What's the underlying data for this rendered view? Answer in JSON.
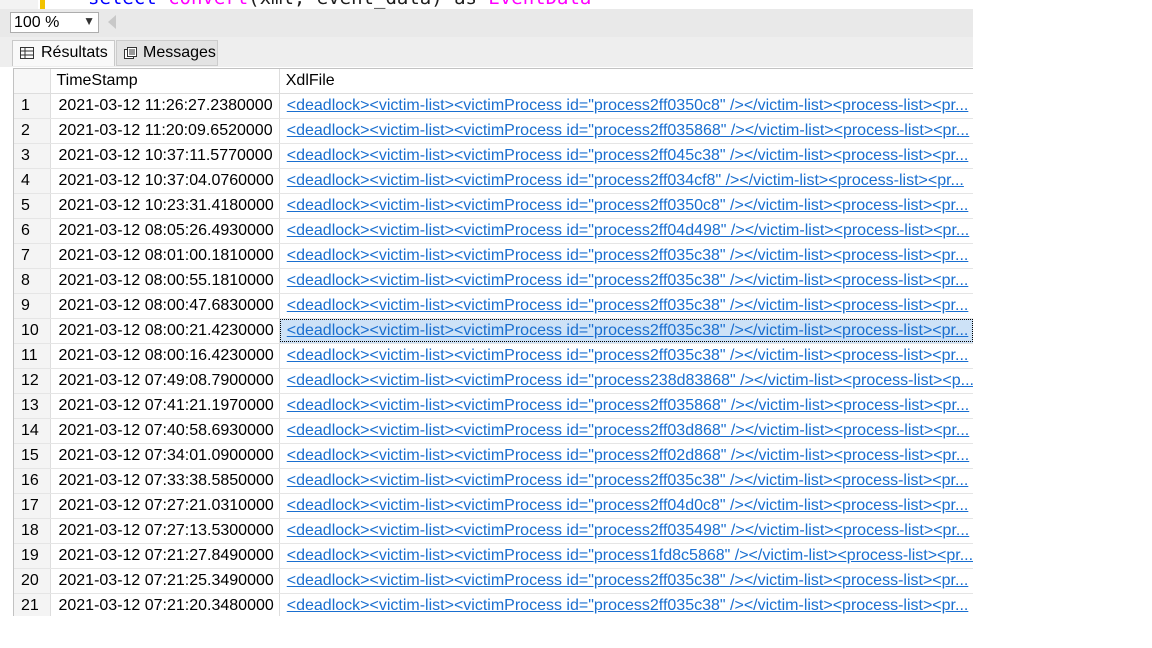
{
  "editor": {
    "code_kw1": "select",
    "code_fn": "convert",
    "code_rest": "(xml, event_data) as",
    "code_alias": "EventData"
  },
  "toolbar": {
    "zoom": "100 %"
  },
  "tabs": [
    {
      "label": "Résultats",
      "icon": "grid-icon",
      "active": true
    },
    {
      "label": "Messages",
      "icon": "messages-icon",
      "active": false
    }
  ],
  "grid": {
    "columns": [
      "TimeStamp",
      "XdlFile"
    ],
    "rows": [
      {
        "num": "1",
        "ts": "2021-03-12 11:26:27.2380000",
        "xdl": "<deadlock><victim-list><victimProcess id=\"process2ff0350c8\" /></victim-list><process-list><pr..."
      },
      {
        "num": "2",
        "ts": "2021-03-12 11:20:09.6520000",
        "xdl": "<deadlock><victim-list><victimProcess id=\"process2ff035868\" /></victim-list><process-list><pr..."
      },
      {
        "num": "3",
        "ts": "2021-03-12 10:37:11.5770000",
        "xdl": "<deadlock><victim-list><victimProcess id=\"process2ff045c38\" /></victim-list><process-list><pr..."
      },
      {
        "num": "4",
        "ts": "2021-03-12 10:37:04.0760000",
        "xdl": "<deadlock><victim-list><victimProcess id=\"process2ff034cf8\" /></victim-list><process-list><pr..."
      },
      {
        "num": "5",
        "ts": "2021-03-12 10:23:31.4180000",
        "xdl": "<deadlock><victim-list><victimProcess id=\"process2ff0350c8\" /></victim-list><process-list><pr..."
      },
      {
        "num": "6",
        "ts": "2021-03-12 08:05:26.4930000",
        "xdl": "<deadlock><victim-list><victimProcess id=\"process2ff04d498\" /></victim-list><process-list><pr..."
      },
      {
        "num": "7",
        "ts": "2021-03-12 08:01:00.1810000",
        "xdl": "<deadlock><victim-list><victimProcess id=\"process2ff035c38\" /></victim-list><process-list><pr..."
      },
      {
        "num": "8",
        "ts": "2021-03-12 08:00:55.1810000",
        "xdl": "<deadlock><victim-list><victimProcess id=\"process2ff035c38\" /></victim-list><process-list><pr..."
      },
      {
        "num": "9",
        "ts": "2021-03-12 08:00:47.6830000",
        "xdl": "<deadlock><victim-list><victimProcess id=\"process2ff035c38\" /></victim-list><process-list><pr..."
      },
      {
        "num": "10",
        "ts": "2021-03-12 08:00:21.4230000",
        "xdl": "<deadlock><victim-list><victimProcess id=\"process2ff035c38\" /></victim-list><process-list><pr...",
        "selected": true
      },
      {
        "num": "11",
        "ts": "2021-03-12 08:00:16.4230000",
        "xdl": "<deadlock><victim-list><victimProcess id=\"process2ff035c38\" /></victim-list><process-list><pr..."
      },
      {
        "num": "12",
        "ts": "2021-03-12 07:49:08.7900000",
        "xdl": "<deadlock><victim-list><victimProcess id=\"process238d83868\" /></victim-list><process-list><p..."
      },
      {
        "num": "13",
        "ts": "2021-03-12 07:41:21.1970000",
        "xdl": "<deadlock><victim-list><victimProcess id=\"process2ff035868\" /></victim-list><process-list><pr..."
      },
      {
        "num": "14",
        "ts": "2021-03-12 07:40:58.6930000",
        "xdl": "<deadlock><victim-list><victimProcess id=\"process2ff03d868\" /></victim-list><process-list><pr..."
      },
      {
        "num": "15",
        "ts": "2021-03-12 07:34:01.0900000",
        "xdl": "<deadlock><victim-list><victimProcess id=\"process2ff02d868\" /></victim-list><process-list><pr..."
      },
      {
        "num": "16",
        "ts": "2021-03-12 07:33:38.5850000",
        "xdl": "<deadlock><victim-list><victimProcess id=\"process2ff035c38\" /></victim-list><process-list><pr..."
      },
      {
        "num": "17",
        "ts": "2021-03-12 07:27:21.0310000",
        "xdl": "<deadlock><victim-list><victimProcess id=\"process2ff04d0c8\" /></victim-list><process-list><pr..."
      },
      {
        "num": "18",
        "ts": "2021-03-12 07:27:13.5300000",
        "xdl": "<deadlock><victim-list><victimProcess id=\"process2ff035498\" /></victim-list><process-list><pr..."
      },
      {
        "num": "19",
        "ts": "2021-03-12 07:21:27.8490000",
        "xdl": "<deadlock><victim-list><victimProcess id=\"process1fd8c5868\" /></victim-list><process-list><pr..."
      },
      {
        "num": "20",
        "ts": "2021-03-12 07:21:25.3490000",
        "xdl": "<deadlock><victim-list><victimProcess id=\"process2ff035c38\" /></victim-list><process-list><pr..."
      },
      {
        "num": "21",
        "ts": "2021-03-12 07:21:20.3480000",
        "xdl": "<deadlock><victim-list><victimProcess id=\"process2ff035c38\" /></victim-list><process-list><pr..."
      }
    ]
  },
  "colors": {
    "link": "#1a6fd0",
    "selection": "#cde2f7",
    "toolbar_bg": "#e9e9e9"
  }
}
